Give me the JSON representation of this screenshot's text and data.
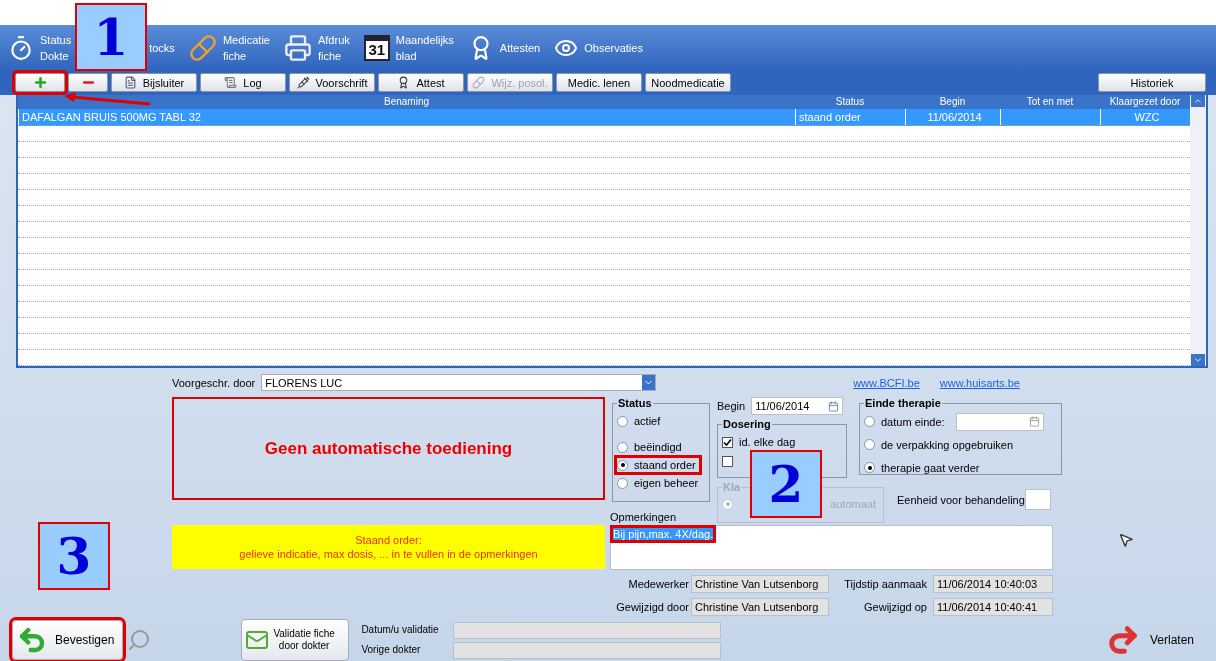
{
  "top_toolbar": [
    {
      "kind": "stopwatch",
      "lines": [
        "Status",
        "Dokte"
      ]
    },
    {
      "kind": "none",
      "lines": [
        "tocks"
      ]
    },
    {
      "kind": "pill",
      "lines": [
        "Medicatie",
        "fiche"
      ]
    },
    {
      "kind": "printer",
      "lines": [
        "Afdruk",
        "fiche"
      ]
    },
    {
      "kind": "calendar",
      "icon_text": "31",
      "lines": [
        "Maandelijks",
        "blad"
      ]
    },
    {
      "kind": "ribbon",
      "lines": [
        "Attesten"
      ]
    },
    {
      "kind": "eye",
      "lines": [
        "Observaties"
      ]
    }
  ],
  "action_bar": {
    "add_highlighted": true,
    "buttons": [
      {
        "label": "Bijsluiter",
        "kind": "leaflet",
        "disabled": false
      },
      {
        "label": "Log",
        "kind": "log",
        "disabled": false
      },
      {
        "label": "Voorschrift",
        "kind": "caduceus",
        "disabled": false
      },
      {
        "label": "Attest",
        "kind": "ribbon",
        "disabled": false
      },
      {
        "label": "Wijz. posol.",
        "kind": "pills",
        "disabled": true
      },
      {
        "label": "Medic. lenen",
        "kind": "none",
        "disabled": false
      },
      {
        "label": "Noodmedicatie",
        "kind": "none",
        "disabled": false
      }
    ],
    "history_button": "Historiek"
  },
  "table": {
    "columns": [
      "Benaming",
      "Status",
      "Begin",
      "Tot en met",
      "Klaargezet door"
    ],
    "rows": [
      {
        "benaming": "DAFALGAN BRUIS 500MG TABL 32",
        "status": "staand order",
        "begin": "11/06/2014",
        "klaargezet_door": "WZC",
        "selected": true
      }
    ]
  },
  "form": {
    "prescriber": {
      "label": "Voorgeschr. door",
      "value": "FLORENS LUC"
    },
    "links": [
      "www.BCFI.be",
      "www.huisarts.be"
    ],
    "warning": "Geen automatische toediening",
    "status": {
      "title": "Status",
      "options": [
        {
          "label": "actief",
          "selected": false,
          "highlighted": false
        },
        {
          "label": "beëindigd",
          "selected": false,
          "highlighted": false
        },
        {
          "label": "staand order",
          "selected": true,
          "highlighted": true
        },
        {
          "label": "eigen beheer",
          "selected": false,
          "highlighted": false
        }
      ]
    },
    "begin": {
      "label": "Begin",
      "value": "11/06/2014"
    },
    "dosering": {
      "title": "Dosering",
      "options": [
        {
          "label": "id. elke dag",
          "checked": true
        },
        {
          "checked": false
        }
      ]
    },
    "klaargezet": {
      "legend": "Kla",
      "option": "automaat",
      "selected": true,
      "disabled": true
    },
    "einde": {
      "title": "Einde therapie",
      "options": [
        {
          "label": "datum einde:",
          "kind": "date",
          "selected": false
        },
        {
          "label": "de verpakking opgebruiken",
          "kind": "plain",
          "selected": false
        },
        {
          "label": "therapie gaat verder",
          "kind": "plain",
          "selected": true
        }
      ]
    },
    "unit_label": "Eenheid voor behandeling",
    "notice": [
      "Staand order:",
      "gelieve indicatie, max dosis, ... in te vullen in de opmerkingen"
    ],
    "remarks": {
      "label": "Opmerkingen",
      "value": "Bij pijn,max. 4X/dag.",
      "highlighted": true
    },
    "audit": [
      {
        "label": "Medewerker",
        "value": "Christine Van Lutsenborg",
        "label2": "Tijdstip aanmaak",
        "value2": "11/06/2014 10:40:03"
      },
      {
        "label": "Gewijzigd door",
        "value": "Christine Van Lutsenborg",
        "label2": "Gewijzigd op",
        "value2": "11/06/2014 10:40:41"
      }
    ]
  },
  "bottom": {
    "confirm": {
      "label": "Bevestigen",
      "highlighted": true
    },
    "validate_button": [
      "Validatie fiche",
      "door dokter"
    ],
    "validation_fields": [
      "Datum/u validatie",
      "Vorige dokter"
    ],
    "exit": "Verlaten"
  },
  "callouts": [
    "1",
    "2",
    "3"
  ]
}
